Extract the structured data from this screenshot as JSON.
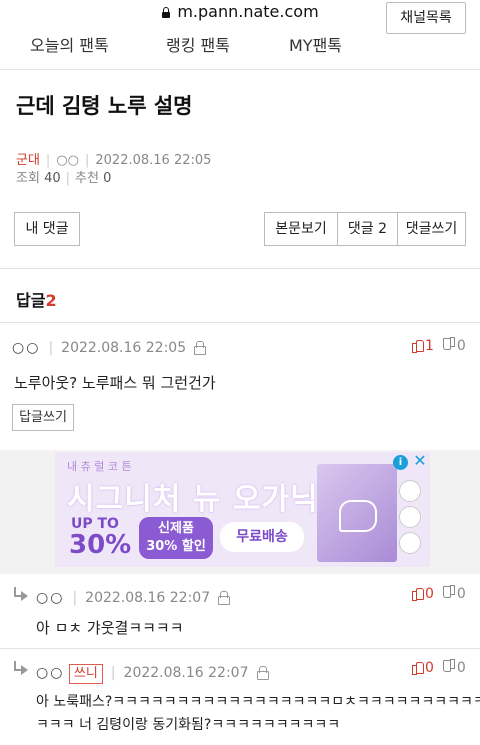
{
  "browser": {
    "url": "m.pann.nate.com"
  },
  "nav": {
    "tabs": [
      "오늘의 팬톡",
      "랭킹 팬톡",
      "MY팬톡"
    ],
    "channel_list": "채널목록"
  },
  "post": {
    "title": "근데 김텽 노루 설명",
    "category": "군대",
    "author": "○○",
    "date": "2022.08.16 22:05",
    "views_label": "조회",
    "views": "40",
    "recommend_label": "추천",
    "recommend": "0"
  },
  "buttons": {
    "my_comments": "내 댓글",
    "view_post": "본문보기",
    "comments_label": "댓글",
    "comments_count": "2",
    "write_comment": "댓글쓰기"
  },
  "replies": {
    "label": "답글",
    "count": "2"
  },
  "comments": [
    {
      "user": "○○",
      "date": "2022.08.16 22:05",
      "up": "1",
      "down": "0",
      "text": "노루아웃? 노루패스 뭐 그런건가",
      "reply_button": "답글쓰기"
    },
    {
      "user": "○○",
      "date": "2022.08.16 22:07",
      "up": "0",
      "down": "0",
      "text": "아 ㅁㅊ 갸웃결ㅋㅋㅋㅋ"
    },
    {
      "user": "○○",
      "badge": "쓰니",
      "date": "2022.08.16 22:07",
      "up": "0",
      "down": "0",
      "text_line1": "아 노룩패스?ㅋㅋㅋㅋㅋㅋㅋㅋㅋㅋㅋㅋㅋㅋㅋㅋㅋㅁㅊㅋㅋㅋㅋㅋㅋㅋㅋㅋㅋ",
      "text_line2": "ㅋㅋㅋ 너 김텽이랑 동기화됨?ㅋㅋㅋㅋㅋㅋㅋㅋㅋㅋ"
    }
  ],
  "ad": {
    "brand": "내 츄 럴 코 튼",
    "headline": "시그니처 뉴 오가닉",
    "upto": "UP TO",
    "percent": "30%",
    "pill1_line1": "신제품",
    "pill1_line2": "30% 할인",
    "pill2": "무료배송",
    "info": "i",
    "close": "✕"
  }
}
